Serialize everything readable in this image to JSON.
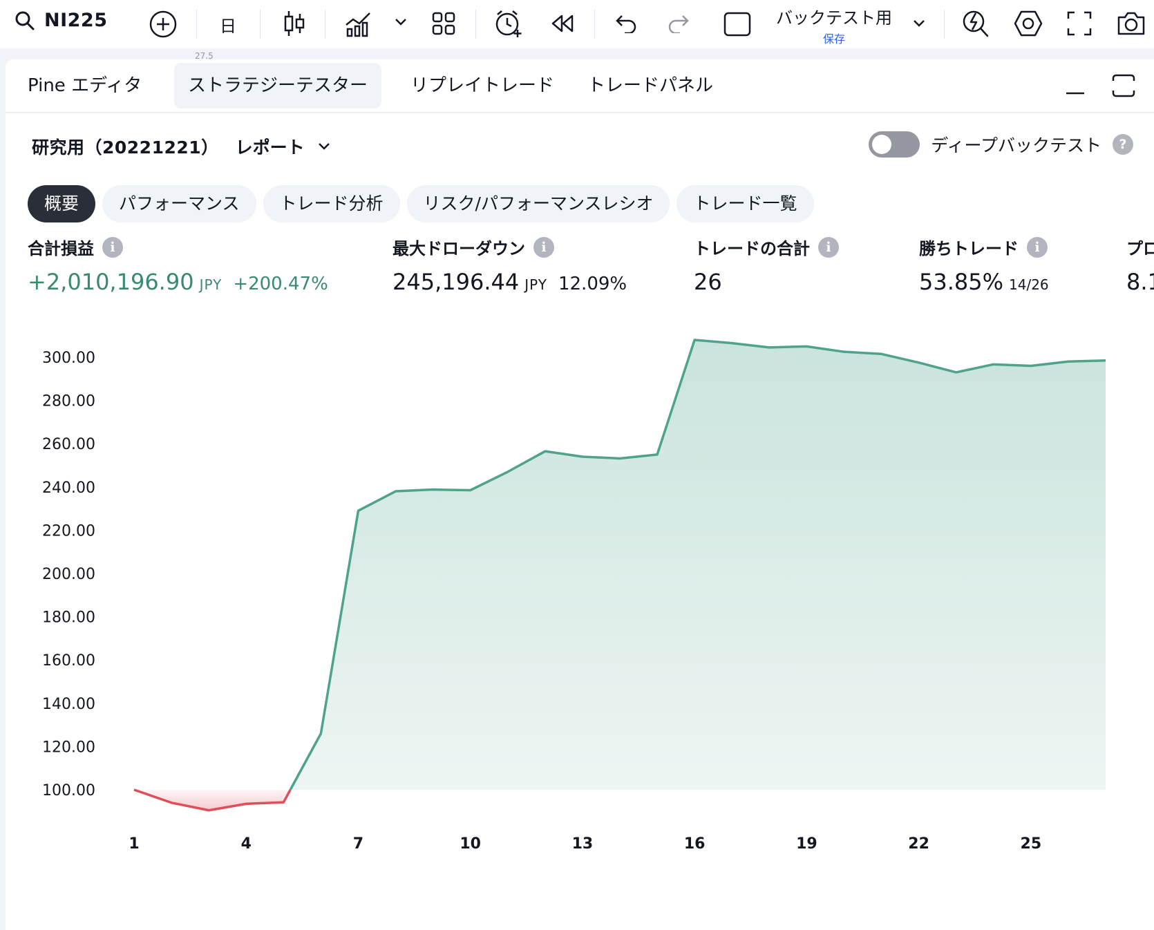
{
  "toolbar": {
    "symbol": "NI225",
    "interval": "日",
    "template_name": "バックテスト用",
    "template_save": "保存"
  },
  "chart_strip": {
    "tick": "27.5"
  },
  "panel": {
    "tabs": [
      {
        "label": "Pine エディタ"
      },
      {
        "label": "ストラテジーテスター"
      },
      {
        "label": "リプレイトレード"
      },
      {
        "label": "トレードパネル"
      }
    ],
    "report_title": "研究用（20221221）",
    "report_sub": "レポート",
    "deep_backtest_label": "ディープバックテスト",
    "help_glyph": "?",
    "info_glyph": "i",
    "subtabs": [
      {
        "label": "概要"
      },
      {
        "label": "パフォーマンス"
      },
      {
        "label": "トレード分析"
      },
      {
        "label": "リスク/パフォーマンスレシオ"
      },
      {
        "label": "トレード一覧"
      }
    ],
    "metrics": {
      "net_profit": {
        "label": "合計損益",
        "value": "+2,010,196.90",
        "unit": "JPY",
        "pct": "+200.47%"
      },
      "max_drawdown": {
        "label": "最大ドローダウン",
        "value": "245,196.44",
        "unit": "JPY",
        "pct": "12.09%"
      },
      "total_trades": {
        "label": "トレードの合計",
        "value": "26"
      },
      "win_trades": {
        "label": "勝ちトレード",
        "value": "53.85%",
        "frac": "14/26"
      },
      "profit_factor": {
        "label": "プロ",
        "value": "8.1"
      }
    }
  },
  "colors": {
    "profit_green": "#3a8a6f",
    "line_green": "#4fa28c",
    "loss_red": "#e04e5a"
  },
  "chart_data": {
    "type": "area",
    "x": [
      1,
      2,
      3,
      4,
      5,
      6,
      7,
      8,
      9,
      10,
      11,
      12,
      13,
      14,
      15,
      16,
      17,
      18,
      19,
      20,
      21,
      22,
      23,
      24,
      25,
      26,
      27
    ],
    "values": [
      100.0,
      94.0,
      90.5,
      93.5,
      94.2,
      126,
      229,
      238,
      238.8,
      238.5,
      247,
      256.5,
      254,
      253.2,
      255,
      308,
      306.5,
      304.5,
      305,
      302.5,
      301.5,
      297.5,
      293,
      296.7,
      296,
      298,
      298.5
    ],
    "baseline": 100,
    "y_ticks": [
      "100.00",
      "120.00",
      "140.00",
      "160.00",
      "180.00",
      "200.00",
      "220.00",
      "240.00",
      "260.00",
      "280.00",
      "300.00"
    ],
    "x_ticks": [
      "1",
      "4",
      "7",
      "10",
      "13",
      "16",
      "19",
      "22",
      "25"
    ],
    "ylim": [
      90,
      310
    ],
    "xlabel": "",
    "ylabel": ""
  }
}
